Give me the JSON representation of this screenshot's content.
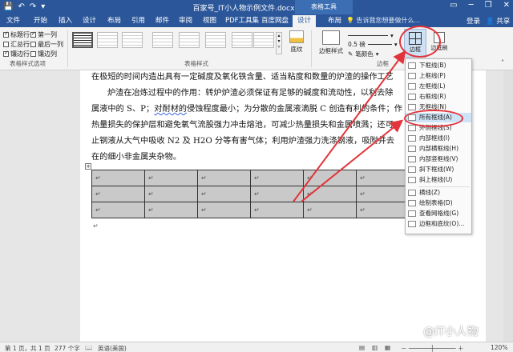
{
  "titlebar": {
    "document_title": "百家号_IT小人物示例文件.docx - Word",
    "context_tools": "表格工具",
    "quick_access": [
      "💾",
      "↶",
      "↷",
      "▾"
    ]
  },
  "tabs": [
    "文件",
    "开始",
    "插入",
    "设计",
    "布局",
    "引用",
    "邮件",
    "审阅",
    "视图",
    "PDF工具集",
    "百度网盘",
    "设计",
    "布局"
  ],
  "active_tab_index": 11,
  "tell_me": "告诉我您想要做什么...",
  "account": {
    "login": "登录",
    "share": "共享"
  },
  "ribbon": {
    "style_options": [
      {
        "label": "标题行",
        "checked": true
      },
      {
        "label": "第一列",
        "checked": true
      },
      {
        "label": "汇总行",
        "checked": false
      },
      {
        "label": "最后一列",
        "checked": false
      },
      {
        "label": "镶边行",
        "checked": true
      },
      {
        "label": "镶边列",
        "checked": false
      }
    ],
    "group_style_options": "表格样式选项",
    "group_table_styles": "表格样式",
    "shading": "底纹",
    "border_styles": "边框样式",
    "pen_weight": "0.5 磅",
    "pen_color": "笔颜色",
    "borders": "边框",
    "border_painter": "边框刷",
    "group_borders": "边框"
  },
  "document": {
    "lines": [
      "在极短的时间内造出具有一定碱度及氧化铁含量、适当粘度和数量的炉渣的操作工艺",
      "炉渣在冶炼过程中的作用：转炉炉渣必须保证有足够的碱度和流动性，以利去除",
      "属液中的 S、P；",
      "对耐材的",
      "侵蚀程度最小；为分散的金属液滴脱 C 创造有利的条件；作",
      "热量损失的保护层和避免氧气流股强力冲击熔池，可减少热量损失和金属喷溅；还可",
      "止钢液从大气中吸收 N2 及 H2O 分等有害气体；利用炉渣强力洗涤钢液，吸附并去",
      "在的细小非金属夹杂物。"
    ],
    "table_rows": 3,
    "table_cols": 6,
    "cell_mark": "↵"
  },
  "border_menu": {
    "items": [
      "下框线(B)",
      "上框线(P)",
      "左框线(L)",
      "右框线(R)",
      "无框线(N)",
      "所有框线(A)",
      "外侧框线(S)",
      "内部框线(I)",
      "内部横框线(H)",
      "内部竖框线(V)",
      "斜下框线(W)",
      "斜上框线(U)",
      "横线(Z)",
      "绘制表格(D)",
      "查看网格线(G)",
      "边框和底纹(O)..."
    ],
    "highlighted_index": 5
  },
  "status": {
    "page": "第 1 页，共 1 页",
    "words": "277 个字",
    "language": "英语(美国)",
    "zoom": "120%"
  },
  "watermark": "@IT小人物",
  "colors": {
    "brand": "#2b579a",
    "annotation": "#e2343a",
    "menu_highlight": "#cfe3f7"
  }
}
